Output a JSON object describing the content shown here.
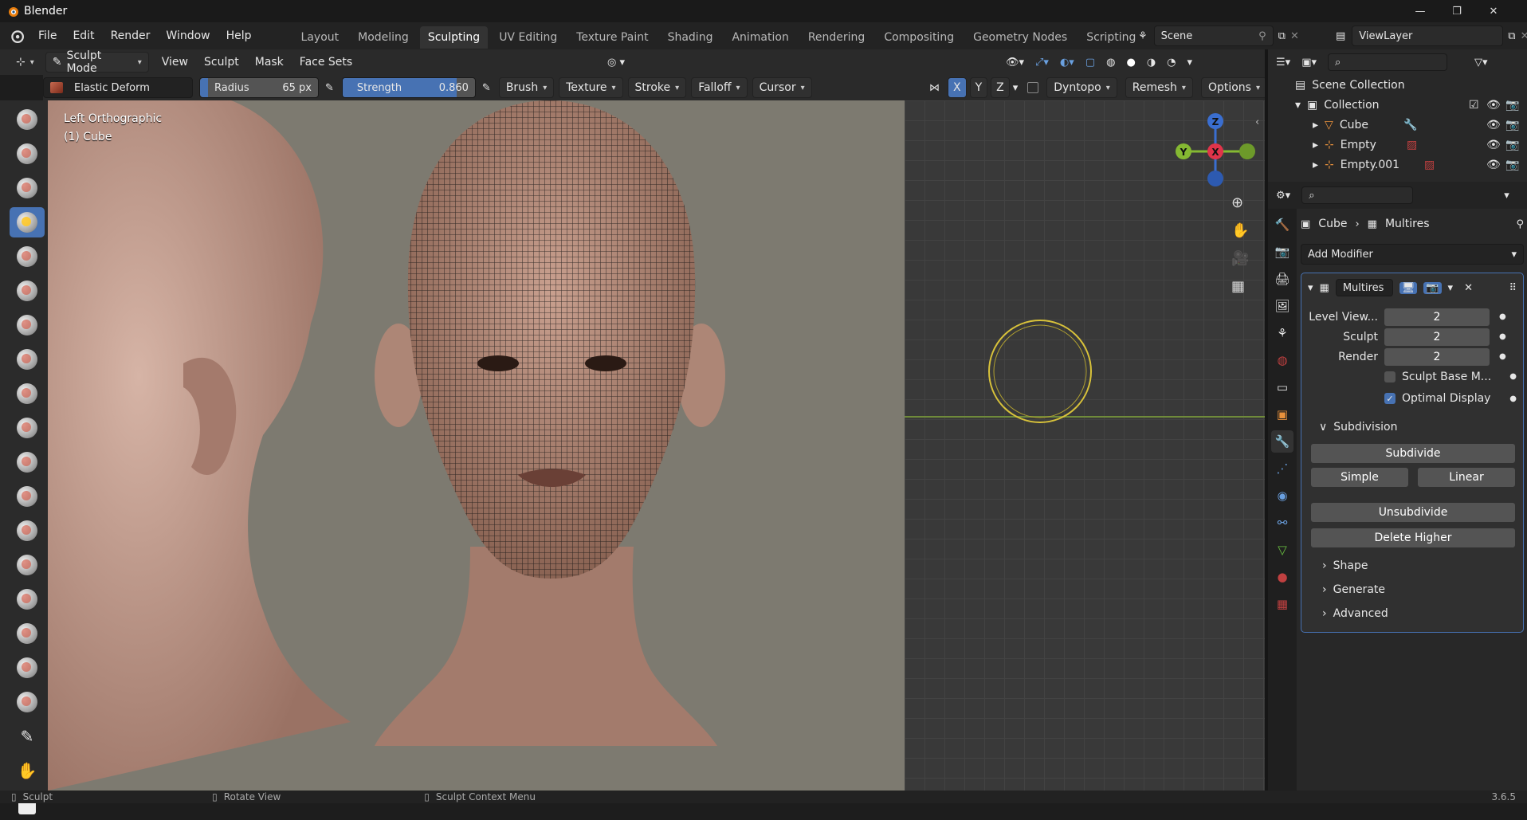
{
  "window": {
    "title": "Blender"
  },
  "menus": [
    "File",
    "Edit",
    "Render",
    "Window",
    "Help"
  ],
  "workspaces": [
    "Layout",
    "Modeling",
    "Sculpting",
    "UV Editing",
    "Texture Paint",
    "Shading",
    "Animation",
    "Rendering",
    "Compositing",
    "Geometry Nodes",
    "Scripting"
  ],
  "active_workspace": "Sculpting",
  "scene": {
    "label": "Scene"
  },
  "viewlayer": {
    "label": "ViewLayer"
  },
  "header": {
    "mode": "Sculpt Mode",
    "menus": [
      "View",
      "Sculpt",
      "Mask",
      "Face Sets"
    ]
  },
  "tool_settings": {
    "brush_name": "Elastic Deform",
    "radius_label": "Radius",
    "radius_value": "65 px",
    "strength_label": "Strength",
    "strength_value": "0.860",
    "strength_fill": 0.86,
    "dropdowns": [
      "Brush",
      "Texture",
      "Stroke",
      "Falloff",
      "Cursor"
    ],
    "axes": [
      "X",
      "Y",
      "Z"
    ],
    "dyntopo": "Dyntopo",
    "remesh": "Remesh",
    "options": "Options"
  },
  "viewport": {
    "view_name": "Left Orthographic",
    "object_name": "(1) Cube"
  },
  "gizmo": {
    "z": "Z",
    "y": "Y",
    "x": "X"
  },
  "outliner": {
    "root": "Scene Collection",
    "collection": "Collection",
    "items": [
      "Cube",
      "Empty",
      "Empty.001"
    ]
  },
  "properties": {
    "breadcrumb_object": "Cube",
    "breadcrumb_modifier": "Multires",
    "add_modifier": "Add Modifier",
    "modifier_name": "Multires",
    "fields": [
      {
        "label": "Level View...",
        "value": "2"
      },
      {
        "label": "Sculpt",
        "value": "2"
      },
      {
        "label": "Render",
        "value": "2"
      }
    ],
    "sculpt_base_mesh": {
      "label": "Sculpt Base M...",
      "checked": false
    },
    "optimal_display": {
      "label": "Optimal Display",
      "checked": true
    },
    "subdivision_header": "Subdivision",
    "subdivide": "Subdivide",
    "simple": "Simple",
    "linear": "Linear",
    "unsubdivide": "Unsubdivide",
    "delete_higher": "Delete Higher",
    "sections": [
      "Shape",
      "Generate",
      "Advanced"
    ]
  },
  "status": {
    "left": "Sculpt",
    "mid": "Rotate View",
    "right": "Sculpt Context Menu",
    "version": "3.6.5"
  },
  "colors": {
    "accent": "#4772b3",
    "header": "#2a2a2a",
    "panel": "#282828",
    "skin": "#b98f80"
  }
}
